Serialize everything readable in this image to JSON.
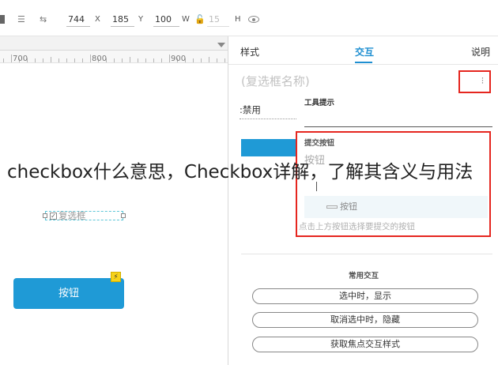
{
  "toolbar": {
    "x_value": "744",
    "x_label": "X",
    "y_value": "185",
    "y_label": "Y",
    "w_value": "100",
    "w_label": "W",
    "h_value": "15",
    "h_label": "H"
  },
  "ruler": {
    "marks": [
      "700",
      "800",
      "900"
    ]
  },
  "canvas": {
    "checkbox_label": "复选框",
    "button_label": "按钮"
  },
  "panel": {
    "tabs": [
      "样式",
      "交互",
      "说明"
    ],
    "active_tab": "交互",
    "name_placeholder": "(复选框名称)",
    "disabled_label": ":禁用",
    "tooltip_label": "工具提示",
    "submit_title": "提交按钮",
    "submit_field": "按钮",
    "submit_row_label": "按钮",
    "submit_hint": "点击上方按钮选择要提交的按钮",
    "common_title": "常用交互",
    "common_actions": [
      "选中时，显示",
      "取消选中时，隐藏",
      "获取焦点交互样式"
    ]
  },
  "overlay": {
    "title": "checkbox什么意思，Checkbox详解，了解其含义与用法"
  },
  "colors": {
    "accent": "#1f8fd1",
    "button": "#1f9ad6",
    "highlight": "#e5261f",
    "lightning": "#f7d21a"
  }
}
